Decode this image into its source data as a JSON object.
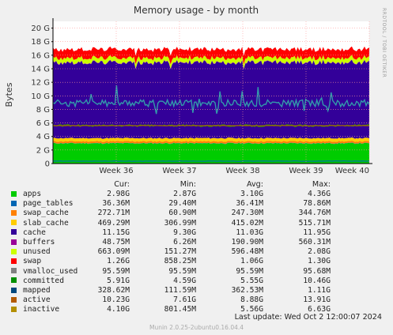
{
  "chart_data": {
    "type": "area",
    "title": "Memory usage - by month",
    "ylabel": "Bytes",
    "side_label": "RRDTOOL / TOBI OETIKER",
    "yticks": [
      "0",
      "2 G",
      "4 G",
      "6 G",
      "8 G",
      "10 G",
      "12 G",
      "14 G",
      "16 G",
      "18 G",
      "20 G"
    ],
    "ylim": [
      0,
      21
    ],
    "x_ticks": [
      "Week 36",
      "Week 37",
      "Week 38",
      "Week 39",
      "Week 40"
    ],
    "x_tick_pos": [
      1.0,
      2.0,
      3.0,
      4.0,
      5.0
    ],
    "xlim": [
      0,
      5.0
    ],
    "stacked_series": [
      {
        "name": "apps",
        "color": "#00cc00",
        "base": 2.98
      },
      {
        "name": "page_tables",
        "color": "#0066b3",
        "base": 0.036
      },
      {
        "name": "swap_cache",
        "color": "#ff8000",
        "base": 0.27
      },
      {
        "name": "slab_cache",
        "color": "#ffcc00",
        "base": 0.47
      },
      {
        "name": "cache",
        "color": "#330099",
        "base": 11.15
      },
      {
        "name": "buffers",
        "color": "#990099",
        "base": 0.049
      },
      {
        "name": "unused",
        "color": "#ccff00",
        "base": 0.66
      },
      {
        "name": "swap",
        "color": "#ff0000",
        "base": 1.26
      }
    ],
    "line_series": [
      {
        "name": "committed",
        "color": "#339900",
        "typical": 5.6
      },
      {
        "name": "mapped",
        "color": "#0066b3",
        "typical": 0.36
      },
      {
        "name": "active",
        "color": "#3399aa",
        "typical": 8.9
      },
      {
        "name": "inactive",
        "color": "#b36b00",
        "typical": 5.6
      }
    ],
    "legend_header": [
      "Cur:",
      "Min:",
      "Avg:",
      "Max:"
    ],
    "legend": [
      {
        "name": "apps",
        "color": "#00cc00",
        "cur": "2.98G",
        "min": "2.87G",
        "avg": "3.10G",
        "max": "4.36G"
      },
      {
        "name": "page_tables",
        "color": "#0066b3",
        "cur": "36.36M",
        "min": "29.40M",
        "avg": "36.41M",
        "max": "78.86M"
      },
      {
        "name": "swap_cache",
        "color": "#ff8000",
        "cur": "272.71M",
        "min": "60.90M",
        "avg": "247.30M",
        "max": "344.76M"
      },
      {
        "name": "slab_cache",
        "color": "#ffcc00",
        "cur": "469.29M",
        "min": "306.99M",
        "avg": "415.02M",
        "max": "515.71M"
      },
      {
        "name": "cache",
        "color": "#330099",
        "cur": "11.15G",
        "min": "9.30G",
        "avg": "11.03G",
        "max": "11.95G"
      },
      {
        "name": "buffers",
        "color": "#990099",
        "cur": "48.75M",
        "min": "6.26M",
        "avg": "190.90M",
        "max": "560.31M"
      },
      {
        "name": "unused",
        "color": "#ccff00",
        "cur": "663.09M",
        "min": "151.27M",
        "avg": "596.48M",
        "max": "2.08G"
      },
      {
        "name": "swap",
        "color": "#ff0000",
        "cur": "1.26G",
        "min": "858.25M",
        "avg": "1.06G",
        "max": "1.30G"
      },
      {
        "name": "vmalloc_used",
        "color": "#808080",
        "cur": "95.59M",
        "min": "95.59M",
        "avg": "95.59M",
        "max": "95.68M"
      },
      {
        "name": "committed",
        "color": "#008f00",
        "cur": "5.91G",
        "min": "4.59G",
        "avg": "5.55G",
        "max": "10.46G"
      },
      {
        "name": "mapped",
        "color": "#00487d",
        "cur": "328.62M",
        "min": "111.59M",
        "avg": "362.53M",
        "max": "1.11G"
      },
      {
        "name": "active",
        "color": "#b35a00",
        "cur": "10.23G",
        "min": "7.61G",
        "avg": "8.88G",
        "max": "13.91G"
      },
      {
        "name": "inactive",
        "color": "#b38f00",
        "cur": "4.10G",
        "min": "801.45M",
        "avg": "5.56G",
        "max": "6.63G"
      }
    ]
  },
  "footer": {
    "last_update": "Last update:  Wed Oct  2 12:00:07 2024",
    "version": "Munin 2.0.25-2ubuntu0.16.04.4"
  }
}
